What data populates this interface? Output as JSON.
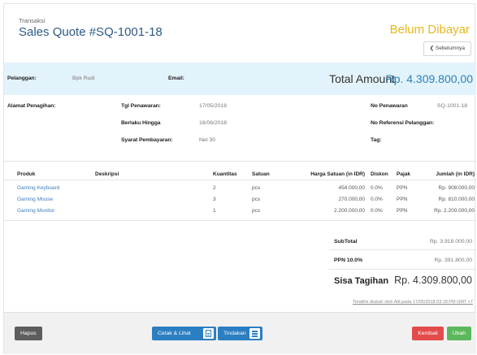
{
  "header": {
    "breadcrumb": "Transaksi",
    "title": "Sales Quote #SQ-1001-18",
    "status": "Belum Dibayar",
    "prev_button": "❮ Sebelumnya"
  },
  "customer": {
    "pelanggan_label": "Pelanggan:",
    "pelanggan_value": "Bpk Rudi",
    "email_label": "Email:",
    "email_value": "",
    "total_label": "Total Amount",
    "total_value": "Rp. 4.309.800,00"
  },
  "details": {
    "alamat_label": "Alamat Penagihan:",
    "tgl_label": "Tgl Penawaran:",
    "tgl_value": "17/05/2018",
    "berlaku_label": "Berlaku Hingga",
    "berlaku_value": "16/06/2018",
    "syarat_label": "Syarat Pembayaran:",
    "syarat_value": "Net 30",
    "no_penawaran_label": "No Penawaran",
    "no_penawaran_value": "SQ-1001-18",
    "no_ref_label": "No Referensi Pelanggan:",
    "tag_label": "Tag:"
  },
  "table": {
    "headers": [
      "Produk",
      "Deskripsi",
      "Kuantitas",
      "Satuan",
      "Harga Satuan (in IDR)",
      "Diskon",
      "Pajak",
      "Jumlah (in IDR)"
    ],
    "rows": [
      [
        "Gaming Keyboard",
        "",
        "2",
        "pcs",
        "454.000,00",
        "0.0%",
        "PPN",
        "Rp. 908.000,00"
      ],
      [
        "Gaming Mouse",
        "",
        "3",
        "pcs",
        "270.000,00",
        "0.0%",
        "PPN",
        "Rp. 810.000,00"
      ],
      [
        "Gaming Monitor",
        "",
        "1",
        "pcs",
        "2.200.000,00",
        "0.0%",
        "PPN",
        "Rp. 2.200.000,00"
      ]
    ]
  },
  "summary": {
    "subtotal_label": "SubTotal",
    "subtotal_value": "Rp. 3.918.000,00",
    "ppn_label": "PPN 10.0%",
    "ppn_value": "Rp. 391.800,00",
    "sisa_label": "Sisa Tagihan",
    "sisa_value": "Rp. 4.309.800,00"
  },
  "audit": "Terakhir diubah oleh Adi pada 17/05/2018 03:18 PM GMT +7",
  "footer": {
    "hapus": "Hapus",
    "cetak": "Cetak & Lihat",
    "tindakan": "Tindakan",
    "kembali": "Kembali",
    "ubah": "Ubah"
  },
  "colors": {
    "title_blue": "#2d5a86",
    "status_yellow": "#e6b81d",
    "link_blue": "#3b7fbf",
    "band_blue": "#e3f3fb",
    "btn_red": "#e34b4b",
    "btn_green": "#5cb85c"
  }
}
